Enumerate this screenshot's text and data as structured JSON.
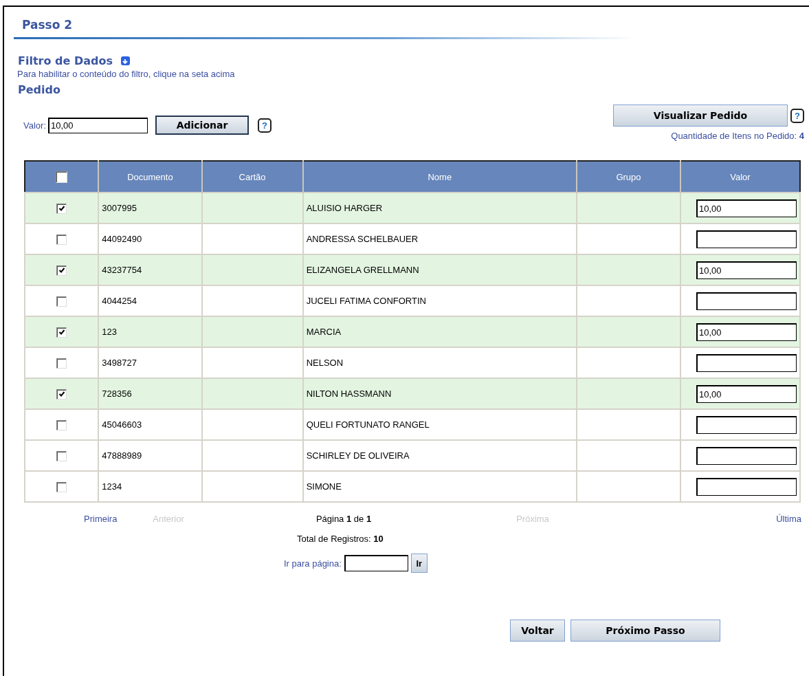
{
  "step_title": "Passo 2",
  "filter": {
    "title": "Filtro de Dados",
    "hint": "Para habilitar o conteúdo do filtro, clique na seta acima",
    "expanded": false
  },
  "order": {
    "title": "Pedido",
    "value_label": "Valor:",
    "value": "10,00",
    "add_button": "Adicionar",
    "help": "?",
    "view_button": "Visualizar Pedido",
    "view_help": "?",
    "count_text": "Quantidade de Itens no Pedido: **4**"
  },
  "table": {
    "select_all_checked": false,
    "columns": [
      "Documento",
      "Cartão",
      "Nome",
      "Grupo",
      "Valor"
    ],
    "rows": [
      {
        "checked": true,
        "documento": "3007995",
        "nome": "ALUISIO HARGER",
        "valor": "10,00"
      },
      {
        "checked": false,
        "documento": "44092490",
        "nome": "ANDRESSA SCHELBAUER"
      },
      {
        "checked": true,
        "documento": "43237754",
        "nome": "ELIZANGELA GRELLMANN",
        "valor": "10,00"
      },
      {
        "checked": false,
        "documento": "4044254",
        "nome": "JUCELI FATIMA CONFORTIN"
      },
      {
        "checked": true,
        "documento": "123",
        "nome": "MARCIA",
        "valor": "10,00"
      },
      {
        "checked": false,
        "documento": "3498727",
        "nome": "NELSON"
      },
      {
        "checked": true,
        "documento": "728356",
        "nome": "NILTON HASSMANN",
        "valor": "10,00"
      },
      {
        "checked": false,
        "documento": "45046603",
        "nome": "QUELI FORTUNATO RANGEL"
      },
      {
        "checked": false,
        "documento": "47888989",
        "nome": "SCHIRLEY DE OLIVEIRA"
      },
      {
        "checked": false,
        "documento": "1234",
        "nome": "SIMONE"
      }
    ]
  },
  "pagination": {
    "links": [
      {
        "label": "Primeira",
        "disabled": false
      },
      {
        "label": "Anterior",
        "disabled": true
      }
    ],
    "page_text": "Página **1** de **1**",
    "next_links": [
      {
        "label": "Próxima",
        "disabled": true
      },
      {
        "label": "Última",
        "disabled": false
      }
    ],
    "total_text": "Total de Registros: **10**",
    "goto_label": "Ir para página:",
    "goto_button": "Ir"
  },
  "buttons": [
    "Voltar",
    "Próximo Passo"
  ]
}
